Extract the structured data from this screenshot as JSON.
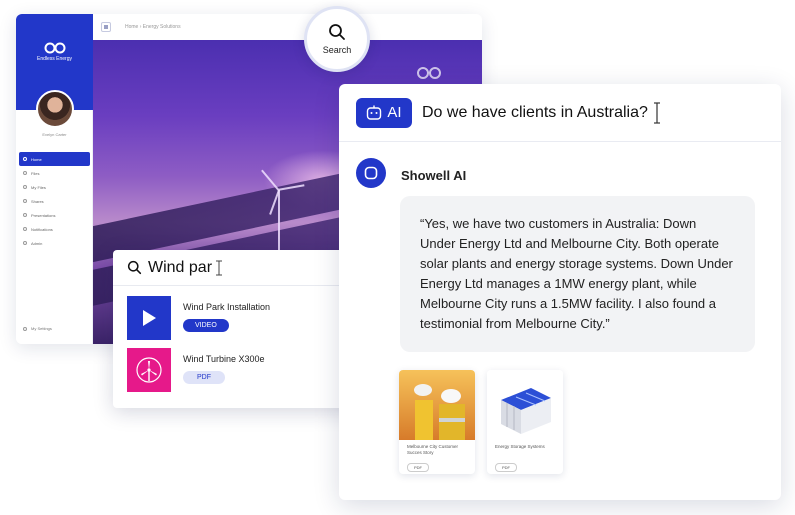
{
  "app": {
    "brand_name": "Endless Energy",
    "user_name": "Evelyn Carter",
    "breadcrumb": "Home › Energy Solutions",
    "nav": [
      "Home",
      "Files",
      "My Files",
      "Shares",
      "Presentations",
      "Notifications",
      "Admin"
    ],
    "settings_label": "My Settings",
    "colors": {
      "primary": "#2237c9",
      "pdf_accent": "#e6198a"
    }
  },
  "search_button": {
    "label": "Search",
    "icon": "search-icon"
  },
  "search_popup": {
    "query": "Wind par",
    "results": [
      {
        "title": "Wind Park Installation",
        "type": "VIDEO",
        "icon": "play-icon"
      },
      {
        "title": "Wind Turbine X300e",
        "type": "PDF",
        "icon": "wind-turbine-icon"
      }
    ]
  },
  "chat": {
    "badge_label": "AI",
    "question": "Do we have clients in Australia?",
    "bot_name": "Showell AI",
    "answer": "“Yes, we have two customers in Australia: Down Under Energy Ltd and Melbourne City. Both operate solar plants and energy storage systems. Down Under Energy Ltd manages a 1MW energy plant, while Melbourne City runs a 1.5MW facility. I also found a testimonial from Melbourne City.”",
    "documents": [
      {
        "title": "Melbourne City Customer Succes Story",
        "type": "PDF"
      },
      {
        "title": "Energy Storage Systems",
        "type": "PDF"
      }
    ]
  }
}
